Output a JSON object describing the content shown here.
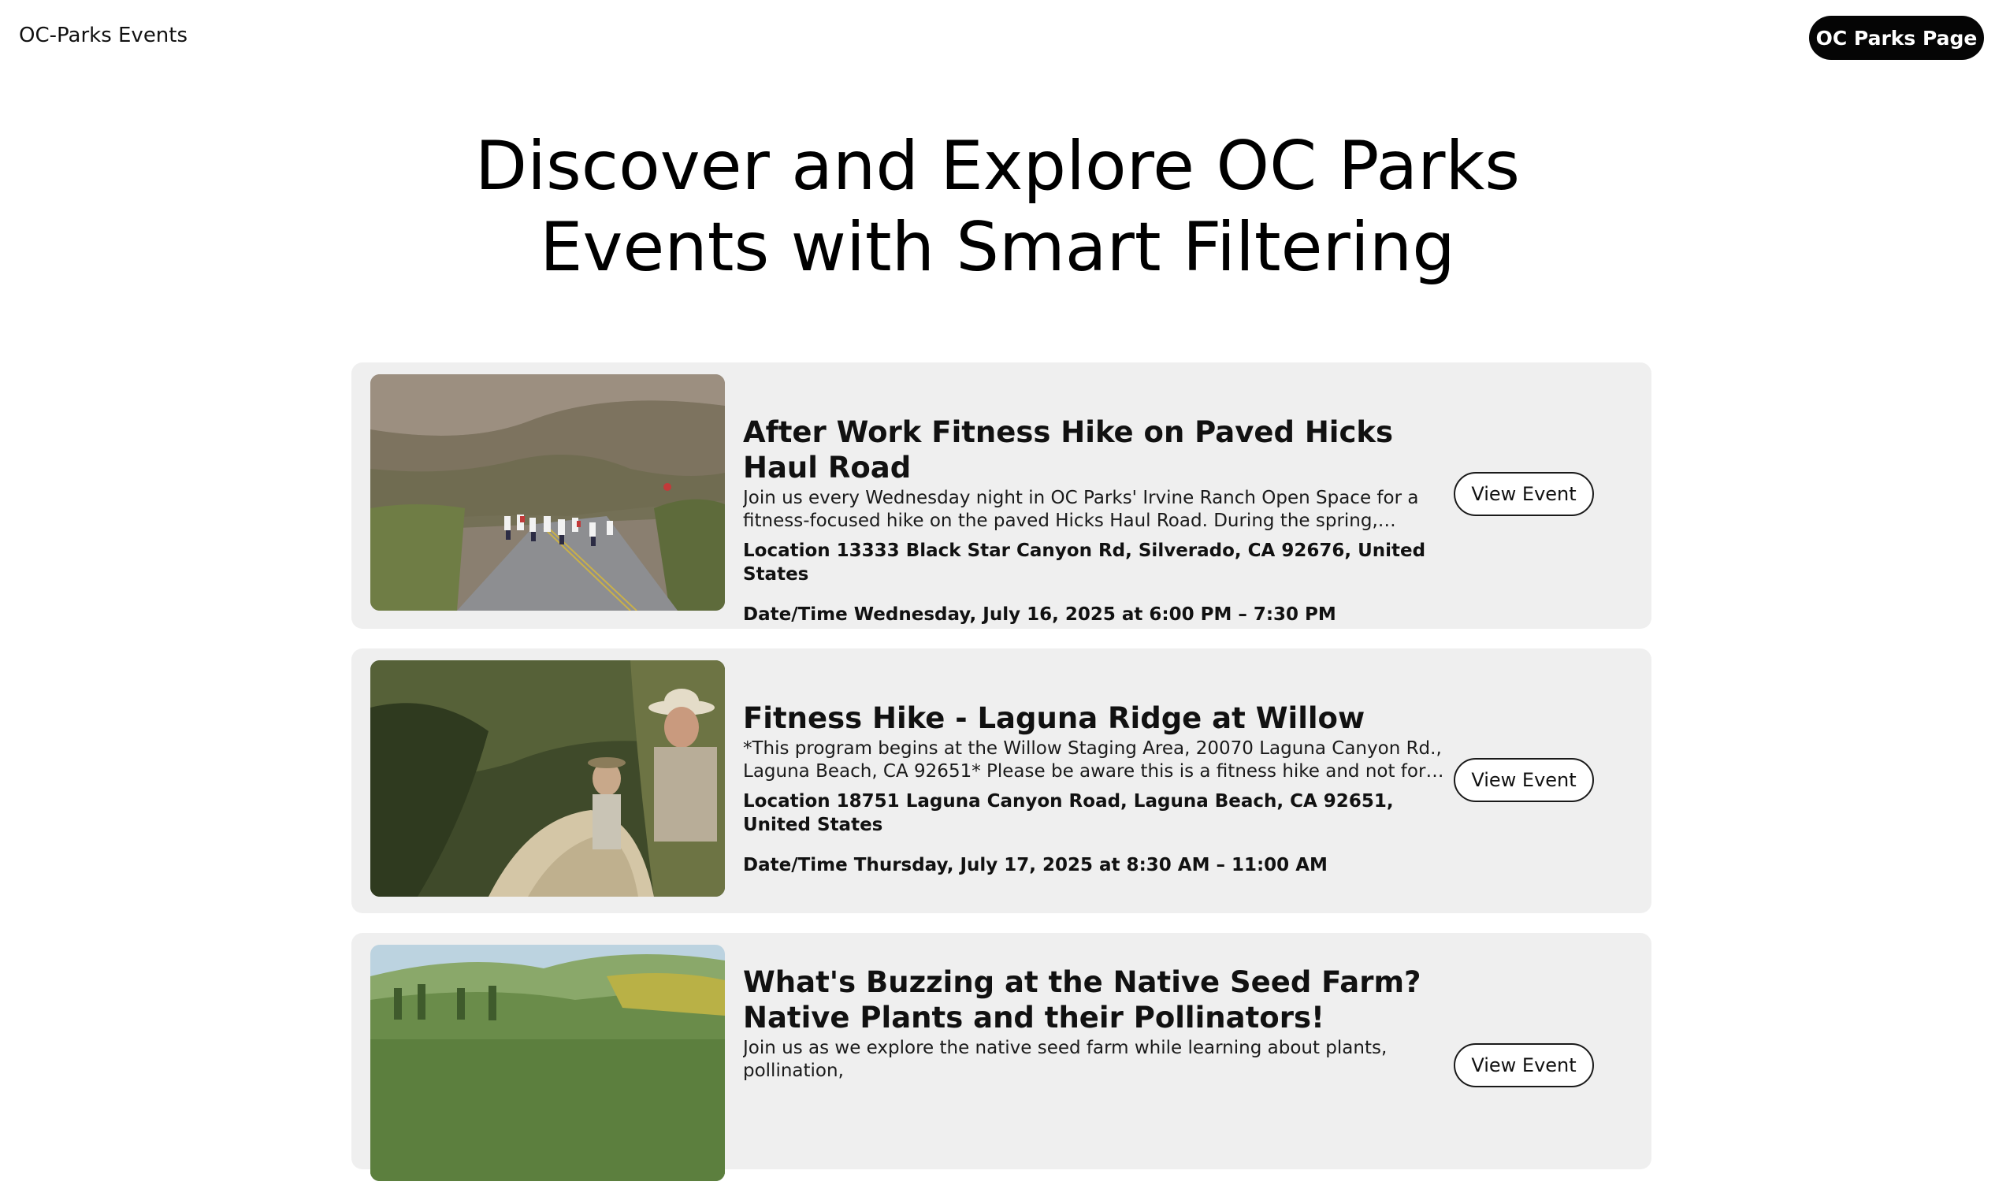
{
  "header": {
    "brand": "OC-Parks Events",
    "nav_button": "OC Parks Page"
  },
  "hero": {
    "line1": "Discover and Explore OC Parks",
    "line2": "Events with Smart Filtering"
  },
  "events": [
    {
      "title": "After Work Fitness Hike on Paved Hicks Haul Road",
      "description": "Join us every Wednesday night in OC Parks' Irvine Ranch Open Space for a fitness-focused hike on the paved Hicks Haul Road. During the spring, summer and fall,...",
      "location": "Location 13333 Black Star Canyon Rd, Silverado, CA 92676, United States",
      "datetime": "Date/Time Wednesday, July 16, 2025 at 6:00 PM – 7:30 PM",
      "button": "View Event",
      "image": "hikers-on-paved-road-photo"
    },
    {
      "title": "Fitness Hike - Laguna Ridge at Willow",
      "description": "*This program begins at the Willow Staging Area, 20070 Laguna Canyon Rd., Laguna Beach, CA 92651* Please be aware this is a fitness hike and not for beginners; the...",
      "location": "Location 18751 Laguna Canyon Road, Laguna Beach, CA 92651, United States",
      "datetime": "Date/Time Thursday, July 17, 2025 at 8:30 AM – 11:00 AM",
      "button": "View Event",
      "image": "hikers-on-rocky-trail-photo"
    },
    {
      "title": "What's Buzzing at the Native Seed Farm? Native Plants and their Pollinators!",
      "description": "Join us as we explore the native seed farm while learning about plants, pollination,",
      "location": "",
      "datetime": "",
      "button": "View Event",
      "image": "seed-farm-hills-photo"
    }
  ],
  "colors": {
    "card_bg": "#efefef",
    "nav_button_bg": "#050505",
    "page_bg": "#ffffff"
  }
}
